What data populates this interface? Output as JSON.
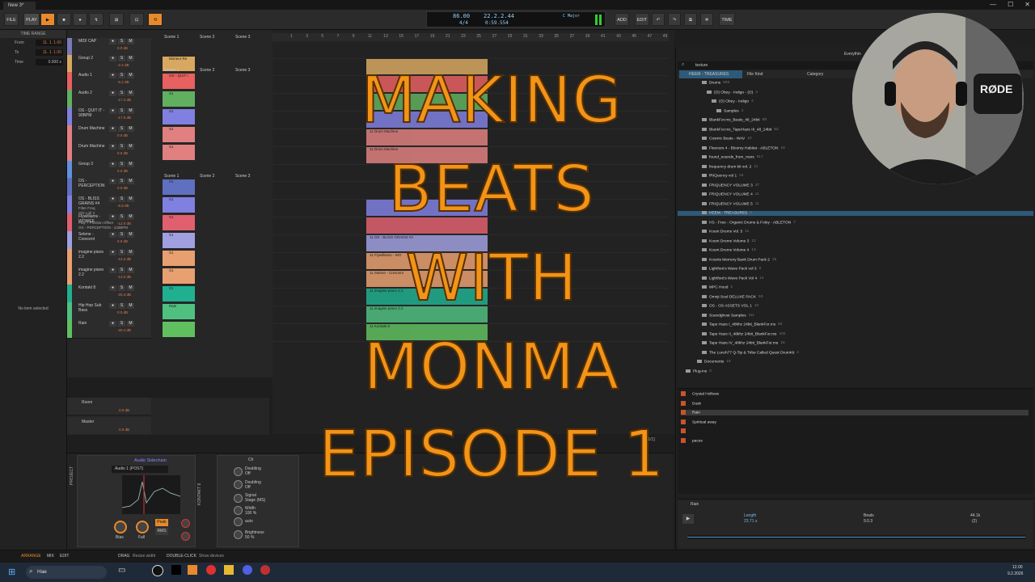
{
  "window": {
    "tab_title": "New 3*",
    "min_icon": "—",
    "max_icon": "☐",
    "close_icon": "✕"
  },
  "toolbar": {
    "file": "FILE",
    "play_label": "PLAY",
    "add": "ADD",
    "edit": "EDIT",
    "time": "TIME"
  },
  "transport": {
    "tempo": "86.00",
    "signature": "4/4",
    "position": "22.2.2.44",
    "time": "0:59.554",
    "key": "C Major"
  },
  "inspector": {
    "title": "TIME RANGE",
    "from_label": "From",
    "from_value": "11. 1. 1.00",
    "to_label": "To",
    "to_value": "11. 1. 1.00",
    "time_label": "Time",
    "time_value": "0.000 s",
    "empty": "No item selected"
  },
  "tracks": [
    {
      "name": "MIDI CAP",
      "vol": "0.0 dB",
      "color": "#7a7ab8"
    },
    {
      "name": "Group 2",
      "vol": "-2.4 dB",
      "color": "#d8a860"
    },
    {
      "name": "Audio 1",
      "vol": "-6.2 dB",
      "color": "#e86060"
    },
    {
      "name": "Audio 2",
      "vol": "-17.4 dB",
      "color": "#60b060"
    },
    {
      "name": "OS - QUIT IT - 90BPM",
      "vol": "-17.9 dB",
      "color": "#8080e0"
    },
    {
      "name": "Drum Machine",
      "vol": "0.0 dB",
      "color": "#e08080"
    },
    {
      "name": "Drum Machine",
      "vol": "0.0 dB",
      "color": "#e08080"
    },
    {
      "name": "Group 3",
      "vol": "0.0 dB",
      "color": "#6090e0"
    },
    {
      "name": "OS - PERCEPTION",
      "vol": "0.0 dB",
      "color": "#6070c0"
    },
    {
      "name": "OS - BLISS GRAINS #4",
      "vol": "-6.8 dB",
      "color": "#8080e0"
    },
    {
      "name": "Flywilliams - WOWEE",
      "vol": "-12.0 dB",
      "color": "#e06070"
    },
    {
      "name": "Selene - Crescent",
      "vol": "0.0 dB",
      "color": "#a0a0e0"
    },
    {
      "name": "imagine piano 2.2",
      "vol": "-12.3 dB",
      "color": "#e8a070"
    },
    {
      "name": "imagine piano 2.2",
      "vol": "-13.0 dB",
      "color": "#e8a070"
    },
    {
      "name": "Kontakt 8",
      "vol": "-20.4 dB",
      "color": "#20b090"
    },
    {
      "name": "Hip Hop Sub Bass",
      "vol": "0.0 dB",
      "color": "#50c080"
    },
    {
      "name": "Rain",
      "vol": "-20.4 dB",
      "color": "#60c060"
    }
  ],
  "automation": {
    "param": "Filter Freq",
    "param_sub": "Gliz Lofi 3",
    "play": "Play 7 Position Offset",
    "play_sub": "OS - PERCEPTION - 132BPM"
  },
  "lower_tracks": [
    {
      "name": "Room",
      "vol": "0.0 dB"
    },
    {
      "name": "Master",
      "vol": "0.0 dB"
    }
  ],
  "scenes": [
    "Scene 1",
    "Scene 2",
    "Scene 3"
  ],
  "clips": [
    "Moneur Re",
    "OS - QUIT I",
    "S1",
    "S1",
    "S1",
    "S1",
    "S1",
    "S1",
    "S1",
    "S1",
    "S1",
    "S1",
    "S1",
    "Rain"
  ],
  "ruler": [
    "1",
    "3",
    "5",
    "7",
    "9",
    "11",
    "13",
    "15",
    "17",
    "19",
    "21",
    "23",
    "25",
    "27",
    "29",
    "31",
    "33",
    "35",
    "37",
    "39",
    "41",
    "43",
    "45",
    "47",
    "49"
  ],
  "arranger_clips": [
    "11 Drum Machine",
    "11 Drum Machine",
    "11 OS - BLISS GRAINS #4",
    "11 Flywilliams - WO",
    "11 Selene - Crescent",
    "11 imagine piano 2.2",
    "11 imagine piano 2.2",
    "11 Kontakt 8"
  ],
  "pager": "[1/1]",
  "device": {
    "panel_label": "PROJECT",
    "title": "Audio Sidechain",
    "source": "Audio 1 (POST)",
    "knob1": "Bias",
    "knob2": "Fall",
    "peak": "Peak",
    "rms": "RMS",
    "fx_label": "KONTAKT 8",
    "fx_title": "Ch",
    "params": [
      {
        "name": "Doubling",
        "val": "Off"
      },
      {
        "name": "Doubling",
        "val": "Off"
      },
      {
        "name": "Signal",
        "val": "Stage (MS)"
      },
      {
        "name": "Width",
        "val": "100 %"
      },
      {
        "name": "auto",
        "val": ""
      },
      {
        "name": "Brightness",
        "val": "50 %"
      }
    ]
  },
  "browser": {
    "title": "Everythin",
    "search": "texture",
    "tabs": [
      "HEEM - TREASURES",
      "File Kind",
      "Category"
    ],
    "items": [
      {
        "name": "Drums",
        "count": "906",
        "lvl": 1
      },
      {
        "name": "(O) Obey - Indigo - (O)",
        "count": "4",
        "lvl": 2
      },
      {
        "name": "(O) Obey - Indigo",
        "count": "4",
        "lvl": 3
      },
      {
        "name": "Samples",
        "count": "4",
        "lvl": 4
      },
      {
        "name": "BlankFor.ms_Beats_48_24bit",
        "count": "58",
        "lvl": 1
      },
      {
        "name": "BlankFor.ms_TapeHaze III_48_24bit",
        "count": "52",
        "lvl": 1
      },
      {
        "name": "Cosmic Beats - WAV",
        "count": "10",
        "lvl": 1
      },
      {
        "name": "Flavours 4 - Bloomy Habitat - ABLETON",
        "count": "16",
        "lvl": 1
      },
      {
        "name": "found_sounds_from_mars",
        "count": "517",
        "lvl": 1
      },
      {
        "name": "frequency drum kit vol. 2",
        "count": "11",
        "lvl": 1
      },
      {
        "name": "fRIQuency vol 1",
        "count": "24",
        "lvl": 1
      },
      {
        "name": "FRIQUENCY VOLUME 3",
        "count": "37",
        "lvl": 1
      },
      {
        "name": "FRIQUENCY VOLUME 4",
        "count": "11",
        "lvl": 1
      },
      {
        "name": "FRIQUENCY VOLUME 5",
        "count": "11",
        "lvl": 1
      },
      {
        "name": "HEEM - TREASURES",
        "count": "6",
        "lvl": 1
      },
      {
        "name": "HS - Free - Organic Drums & Foley - ABLETON",
        "count": "7",
        "lvl": 1
      },
      {
        "name": "Kount Drums Vol. 5",
        "count": "11",
        "lvl": 1
      },
      {
        "name": "Kount Drums Volume 3",
        "count": "12",
        "lvl": 1
      },
      {
        "name": "Kount Drums Volume 4",
        "count": "13",
        "lvl": 1
      },
      {
        "name": "Kounts Memory Bank Drum Pack 2",
        "count": "16",
        "lvl": 1
      },
      {
        "name": "Lightfoot's Wave Pack vol 3",
        "count": "6",
        "lvl": 1
      },
      {
        "name": "Lightfoot's Wave Pack Vol 4",
        "count": "14",
        "lvl": 1
      },
      {
        "name": "MPC Hood",
        "count": "2",
        "lvl": 1
      },
      {
        "name": "Omnji Soul DELUXE PACK",
        "count": "53",
        "lvl": 1
      },
      {
        "name": "OS - OS ASSETS VOL 1",
        "count": "10",
        "lvl": 1
      },
      {
        "name": "Soundghost Samples",
        "count": "111",
        "lvl": 1
      },
      {
        "name": "Tape Haze I_48khz 24bit_BlankFor.ms",
        "count": "82",
        "lvl": 1
      },
      {
        "name": "Tape Haze II_48khz 24bit_BlankFor.ms",
        "count": "102",
        "lvl": 1
      },
      {
        "name": "Tape Haze IV_48khz 24bit_BlankFor.ms",
        "count": "16",
        "lvl": 1
      },
      {
        "name": "The Lunch77 Q-Tip & Tribe Called Quest DrumKit",
        "count": "2",
        "lvl": 1
      },
      {
        "name": "Documents",
        "count": "19",
        "lvl": 0
      },
      {
        "name": "Plug-ins",
        "count": "0",
        "lvl": -1
      }
    ],
    "results": [
      "Crystal Hollows",
      "Dusk",
      "Rain",
      "Spiritual away",
      "",
      "paces"
    ],
    "preview_name": "Rain",
    "length_label": "Length",
    "length_value": "23.71 s",
    "beats_label": "Beats",
    "beats_value": "9.0.3",
    "khz_label": "44.1k",
    "khz_value": "(2)"
  },
  "webcam_logo": "RØDE",
  "statusbar": {
    "arrange": "ARRANGE",
    "mix": "MIX",
    "edit": "EDIT",
    "drag": "DRAG",
    "resize": "Resize width",
    "dbl": "DOUBLE-CLICK",
    "show": "Show devices"
  },
  "taskbar": {
    "search": "Hae",
    "time": "12.00",
    "date": "9.2.2026"
  },
  "overlay": {
    "line1": "MAKING",
    "line2": "BEATS",
    "line3": "WITH",
    "line4": "MONMA",
    "line5": "EPISODE 1"
  },
  "colors": {
    "accent": "#e88a2c",
    "overlay": "#f29418",
    "selection": "#2e5a7a"
  }
}
